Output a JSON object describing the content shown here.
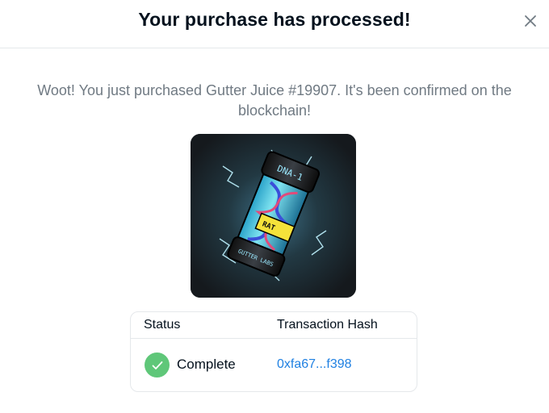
{
  "modal": {
    "title": "Your purchase has processed!",
    "close_icon": "close-icon",
    "message": "Woot! You just purchased Gutter Juice #19907. It's been confirmed on the blockchain!"
  },
  "nft": {
    "image_icon": "gutter-juice-canister-image",
    "label_top": "DNA-1",
    "label_mid": "RAT",
    "label_bottom": "GUTTER LABS"
  },
  "table": {
    "headers": {
      "status": "Status",
      "hash": "Transaction Hash"
    },
    "row": {
      "status": "Complete",
      "status_icon": "check-icon",
      "hash": "0xfa67...f398"
    }
  },
  "colors": {
    "title": "#04111d",
    "message": "#707a83",
    "link": "#2081e2",
    "success": "#5fc779",
    "border": "#e5e8eb"
  }
}
